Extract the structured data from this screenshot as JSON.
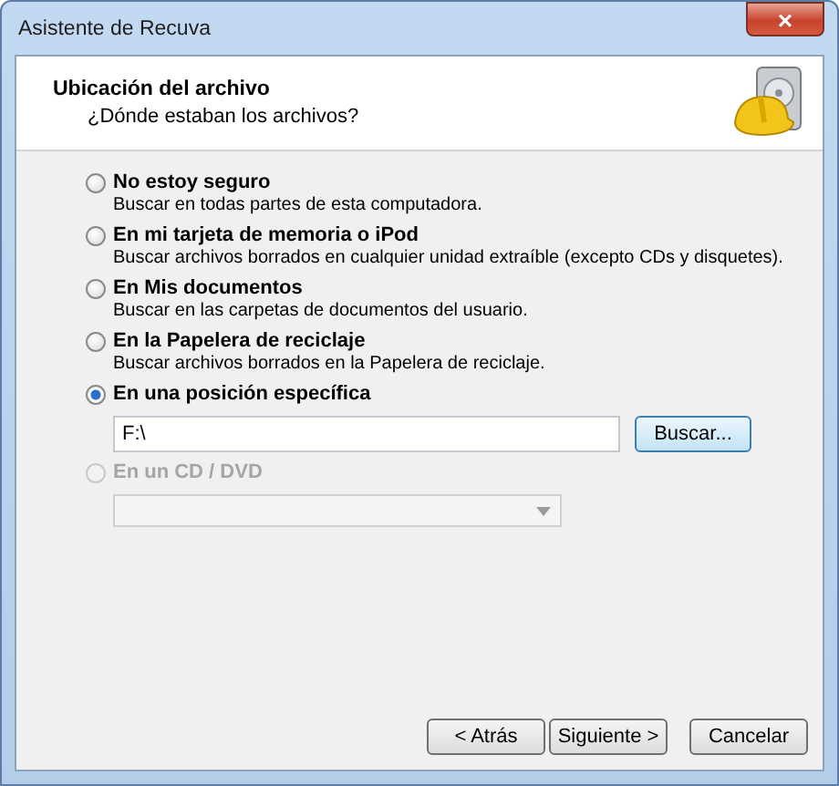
{
  "window": {
    "title": "Asistente de Recuva",
    "close": "×"
  },
  "header": {
    "title": "Ubicación del archivo",
    "subtitle": "¿Dónde estaban los archivos?"
  },
  "options": [
    {
      "kind": "plain",
      "label": "No estoy seguro",
      "description": "Buscar en todas partes de esta computadora.",
      "selected": false,
      "disabled": false
    },
    {
      "kind": "plain",
      "label": "En mi tarjeta de memoria o iPod",
      "description": "Buscar archivos borrados en cualquier unidad extraíble (excepto CDs y disquetes).",
      "selected": false,
      "disabled": false
    },
    {
      "kind": "plain",
      "label": "En Mis documentos",
      "description": "Buscar en las carpetas de documentos del usuario.",
      "selected": false,
      "disabled": false
    },
    {
      "kind": "plain",
      "label": "En la Papelera de reciclaje",
      "description": "Buscar archivos borrados en la Papelera de reciclaje.",
      "selected": false,
      "disabled": false
    },
    {
      "kind": "path",
      "label": "En una posición específica",
      "selected": true,
      "disabled": false,
      "value": "F:\\",
      "button": "Buscar..."
    },
    {
      "kind": "combo",
      "label": "En un CD / DVD",
      "selected": false,
      "disabled": true
    }
  ],
  "buttons": [
    {
      "label": "< Atrás"
    },
    {
      "label": "Siguiente >"
    },
    {
      "label": "Cancelar"
    }
  ]
}
